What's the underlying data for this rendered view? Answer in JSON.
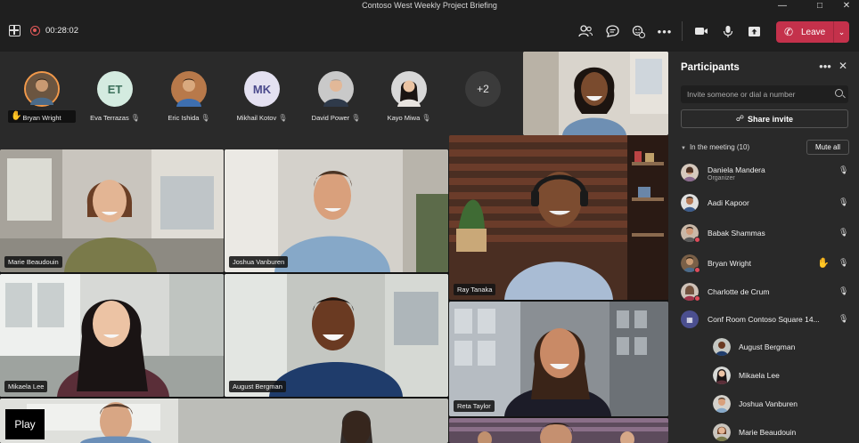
{
  "window": {
    "title": "Contoso West Weekly Project Briefing",
    "minimize_icon": "minimize-icon",
    "maximize_icon": "maximize-icon",
    "close_icon": "close-icon"
  },
  "toolbar": {
    "timer": "00:28:02",
    "leave_label": "Leave",
    "buttons": [
      "participants-icon",
      "chat-icon",
      "reactions-icon",
      "more-icon",
      "camera-icon",
      "mic-icon",
      "share-icon"
    ]
  },
  "avatar_strip": [
    {
      "name": "Bryan Wright",
      "initials": "",
      "hand_raised": true,
      "mic": false
    },
    {
      "name": "Eva Terrazas",
      "initials": "ET",
      "mic": true
    },
    {
      "name": "Eric Ishida",
      "initials": "",
      "mic": true
    },
    {
      "name": "Mikhail Kotov",
      "initials": "MK",
      "mic": true
    },
    {
      "name": "David Power",
      "initials": "",
      "mic": true
    },
    {
      "name": "Kayo Miwa",
      "initials": "",
      "mic": true
    },
    {
      "name": "",
      "initials": "+2",
      "mic": false
    }
  ],
  "tiles": [
    {
      "name": "Marie Beaudouin"
    },
    {
      "name": "Joshua Vanburen"
    },
    {
      "name": "Ray Tanaka"
    },
    {
      "name": "Mikaela Lee"
    },
    {
      "name": "August Bergman"
    },
    {
      "name": "Reta Taylor"
    },
    {
      "name": ""
    },
    {
      "name": ""
    },
    {
      "name": ""
    }
  ],
  "play_label": "Play",
  "panel": {
    "title": "Participants",
    "invite_placeholder": "Invite someone or dial a number",
    "share_invite": "Share invite",
    "section_label": "In the meeting (10)",
    "mute_all": "Mute all",
    "participants": [
      {
        "name": "Daniela Mandera",
        "role": "Organizer",
        "mic": true
      },
      {
        "name": "Aadi Kapoor",
        "role": "",
        "mic": true
      },
      {
        "name": "Babak Shammas",
        "role": "",
        "mic": true
      },
      {
        "name": "Bryan Wright",
        "role": "",
        "mic": true,
        "hand_raised": true
      },
      {
        "name": "Charlotte de Crum",
        "role": "",
        "mic": true
      },
      {
        "name": "Conf Room Contoso Square 14...",
        "role": "",
        "mic": true,
        "room": true
      },
      {
        "name": "August Bergman",
        "role": "",
        "mic": false
      },
      {
        "name": "Mikaela Lee",
        "role": "",
        "mic": false
      },
      {
        "name": "Joshua Vanburen",
        "role": "",
        "mic": false
      },
      {
        "name": "Marie Beaudouin",
        "role": "",
        "mic": false
      }
    ]
  },
  "colors": {
    "background": "#1f1f1f",
    "panel": "#292929",
    "leave_red": "#c4314b",
    "hand_orange": "#f2a33a",
    "speaker_ring": "#f2994a"
  }
}
